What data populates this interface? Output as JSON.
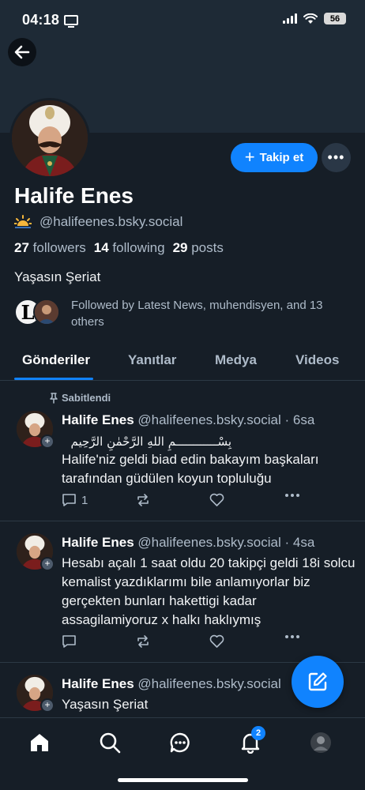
{
  "status_bar": {
    "time": "04:18",
    "battery": "56"
  },
  "profile": {
    "display_name": "Halife Enes",
    "status_emoji": "sunrise-icon",
    "handle": "@halifeenes.bsky.social",
    "followers_count": "27",
    "followers_label": "followers",
    "following_count": "14",
    "following_label": "following",
    "posts_count": "29",
    "posts_label": "posts",
    "bio": "Yaşasın Şeriat",
    "followed_by": "Followed by Latest News, muhendisyen, and 13 others",
    "follow_label": "Takip et",
    "more_label": "•••"
  },
  "tabs": [
    {
      "label": "Gönderiler",
      "active": true
    },
    {
      "label": "Yanıtlar",
      "active": false
    },
    {
      "label": "Medya",
      "active": false
    },
    {
      "label": "Videos",
      "active": false
    }
  ],
  "posts": [
    {
      "pinned_label": "Sabitlendi",
      "author": "Halife Enes",
      "meta": "@halifeenes.bsky.social · 6sa",
      "arabic": "بِسْــــــــــــمِ اللهِ الرَّحْمٰنِ الرَّحِيم",
      "text": "Halife'niz geldi biad edin bakayım başkaları tarafından güdülen koyun topluluğu",
      "reply_count": "1"
    },
    {
      "author": "Halife Enes",
      "meta": "@halifeenes.bsky.social · 4sa",
      "text": "Hesabı açalı 1 saat oldu 20 takipçi geldi 18i solcu kemalist yazdıklarımı bile anlamıyorlar biz gerçekten bunları hakettigi kadar assagilamiyoruz x halkı haklıymış",
      "reply_count": ""
    },
    {
      "author": "Halife Enes",
      "meta": "@halifeenes.bsky.social",
      "text": "Yaşasın Şeriat"
    }
  ],
  "nav": {
    "notifications_badge": "2"
  },
  "colors": {
    "accent": "#1083fe",
    "background": "#161e27",
    "banner": "#1e2a36",
    "muted_text": "#aebbc9"
  }
}
